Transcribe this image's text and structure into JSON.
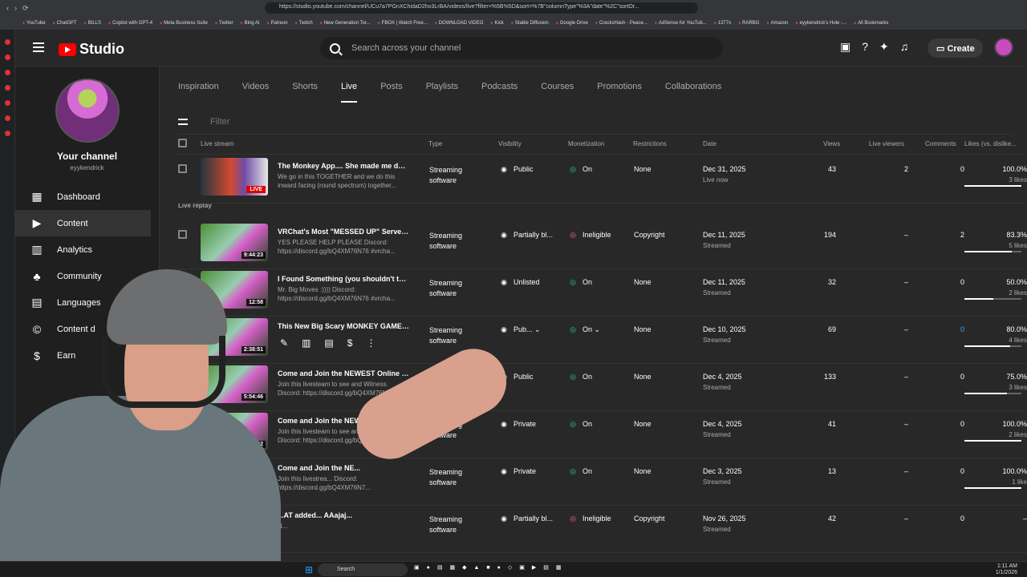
{
  "browser": {
    "url": "https://studio.youtube.com/channel/UCu7a7PGnXChidaD2ho3LrBA/videos/live?filter=%5B%5D&sort=%7B\"columnType\"%3A\"date\"%2C\"sortOr...",
    "bookmarks": [
      "YouTube",
      "ChatGPT",
      "BILLS",
      "Copilot with GPT-4",
      "Meta Business Suite",
      "Twitter",
      "Bing AI",
      "Patreon",
      "Twitch",
      "New Generation Tor...",
      "FBOX | Watch Free...",
      "DOWNLOAD VIDEO",
      "Kick",
      "Stable Diffusion",
      "Google Drive",
      "CracksHash - Peace...",
      "AdSense for YouTub...",
      "1377x",
      "RARBG",
      "Amazon",
      "eyykendrick's Hole -...",
      "All Bookmarks"
    ]
  },
  "header": {
    "brand": "Studio",
    "search_placeholder": "Search across your channel",
    "create_label": "Create"
  },
  "sidebar": {
    "channel_title": "Your channel",
    "handle": "eyykendrick",
    "items": [
      {
        "label": "Dashboard",
        "icon": "dashboard-icon"
      },
      {
        "label": "Content",
        "icon": "content-icon"
      },
      {
        "label": "Analytics",
        "icon": "analytics-icon"
      },
      {
        "label": "Community",
        "icon": "community-icon"
      },
      {
        "label": "Languages",
        "icon": "languages-icon"
      },
      {
        "label": "Content d",
        "icon": "copyright-icon"
      },
      {
        "label": "Earn",
        "icon": "earn-icon"
      }
    ]
  },
  "tabs": [
    "Inspiration",
    "Videos",
    "Shorts",
    "Live",
    "Posts",
    "Playlists",
    "Podcasts",
    "Courses",
    "Promotions",
    "Collaborations"
  ],
  "filter": {
    "placeholder": "Filter"
  },
  "table": {
    "headers": [
      "Live stream",
      "Type",
      "Visibility",
      "Monetization",
      "Restrictions",
      "Date",
      "Views",
      "Live viewers",
      "Comments",
      "Likes (vs. dislike..."
    ],
    "section_label": "Live replay",
    "rows": [
      {
        "title": "The Monkey App.... She made me do t...",
        "description": "We go in this TOGETHER and we do this inward facing (round spectrum) together...",
        "badge": "LIVE",
        "type": "Streaming software",
        "visibility": "Public",
        "monetization": "On",
        "restrictions": "None",
        "date": "Dec 31, 2025",
        "date_sub": "Live now",
        "views": "43",
        "viewers": "2",
        "comments": "0",
        "likes": "100.0%",
        "like_count": "3 likes",
        "like_ratio": 1
      },
      {
        "title": "VRChat's Most \"MESSED UP\" Server.... ...",
        "description": "YES PLEASE HELP PLEASE Discord: https://discord.gg/bQ4XM76N76 #vrcha...",
        "badge": "9:44:23",
        "type": "Streaming software",
        "visibility": "Partially bl...",
        "monetization": "Ineligible",
        "restrictions": "Copyright",
        "date": "Dec 11, 2025",
        "date_sub": "Streamed",
        "views": "194",
        "viewers": "–",
        "comments": "2",
        "likes": "83.3%",
        "like_count": "5 likes",
        "like_ratio": 0.833
      },
      {
        "title": "I Found Something (you shouldn't talk ...",
        "description": "Mr. Big Moves :)))) Discord: https://discord.gg/bQ4XM76N76 #vrcha...",
        "badge": "12:58",
        "type": "Streaming software",
        "visibility": "Unlisted",
        "monetization": "On",
        "restrictions": "None",
        "date": "Dec 11, 2025",
        "date_sub": "Streamed",
        "views": "32",
        "viewers": "–",
        "comments": "0",
        "likes": "50.0%",
        "like_count": "2 likes",
        "like_ratio": 0.5
      },
      {
        "title": "This New Big Scary MONKEY GAME c...",
        "description": "",
        "badge": "2:38:51",
        "type": "Streaming software",
        "visibility": "Pub...",
        "monetization": "On",
        "restrictions": "None",
        "date": "Dec 10, 2025",
        "date_sub": "Streamed",
        "views": "69",
        "viewers": "–",
        "comments": "0",
        "likes": "80.0%",
        "like_count": "4 likes",
        "like_ratio": 0.8
      },
      {
        "title": "Come and Join the NEWEST Online V...",
        "description": "Join this livesteam to see and Witness. Discord: https://discord.gg/bQ4XM76N7...",
        "badge": "5:54:46",
        "type": "Streaming software",
        "visibility": "Public",
        "monetization": "On",
        "restrictions": "None",
        "date": "Dec 4, 2025",
        "date_sub": "Streamed",
        "views": "133",
        "viewers": "–",
        "comments": "0",
        "likes": "75.0%",
        "like_count": "3 likes",
        "like_ratio": 0.75
      },
      {
        "title": "Come and Join the NEWEST Online V...",
        "description": "Join this livesteam to see and Witness. Discord: https://discord.gg/bQ4XM...",
        "badge": "22",
        "type": "Streaming software",
        "visibility": "Private",
        "monetization": "On",
        "restrictions": "None",
        "date": "Dec 4, 2025",
        "date_sub": "Streamed",
        "views": "41",
        "viewers": "–",
        "comments": "0",
        "likes": "100.0%",
        "like_count": "2 likes",
        "like_ratio": 1
      },
      {
        "title": "Come and Join the NE...",
        "description": "Join this livestrea... Discord: https://discord.gg/bQ4XM76N7...",
        "badge": "",
        "type": "Streaming software",
        "visibility": "Private",
        "monetization": "On",
        "restrictions": "None",
        "date": "Dec 3, 2025",
        "date_sub": "Streamed",
        "views": "13",
        "viewers": "–",
        "comments": "0",
        "likes": "100.0%",
        "like_count": "1 like",
        "like_ratio": 1
      },
      {
        "title": "...AT added... AAajaj...",
        "description": "N...",
        "badge": "",
        "type": "Streaming software",
        "visibility": "Partially bl...",
        "monetization": "Ineligible",
        "restrictions": "Copyright",
        "date": "Nov 26, 2025",
        "date_sub": "Streamed",
        "views": "42",
        "viewers": "–",
        "comments": "0",
        "likes": "–",
        "like_count": "",
        "like_ratio": 0
      }
    ]
  },
  "taskbar": {
    "search": "Search",
    "time": "1:11 AM",
    "date": "1/1/2026"
  }
}
